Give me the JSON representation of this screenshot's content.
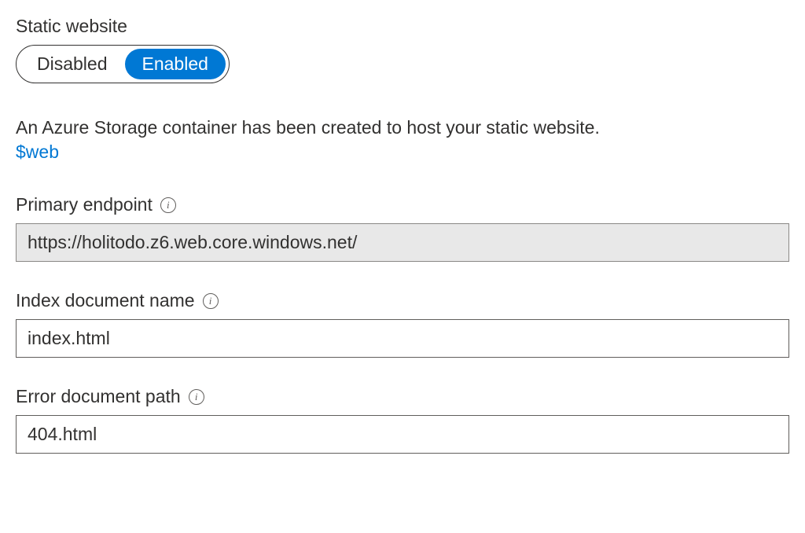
{
  "staticWebsite": {
    "label": "Static website",
    "toggle": {
      "disabled": "Disabled",
      "enabled": "Enabled"
    }
  },
  "description": "An Azure Storage container has been created to host your static website.",
  "containerLink": "$web",
  "primaryEndpoint": {
    "label": "Primary endpoint",
    "value": "https://holitodo.z6.web.core.windows.net/"
  },
  "indexDocument": {
    "label": "Index document name",
    "value": "index.html"
  },
  "errorDocument": {
    "label": "Error document path",
    "value": "404.html"
  },
  "infoIconGlyph": "i"
}
